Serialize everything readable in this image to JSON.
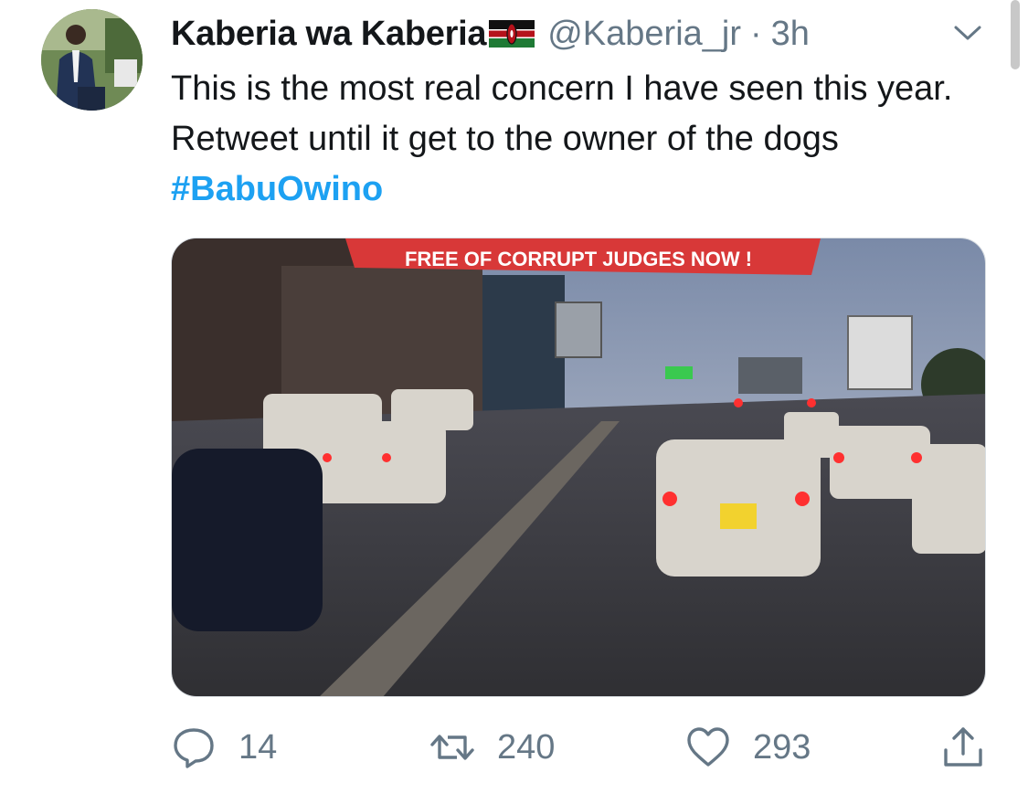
{
  "tweet": {
    "author_name": "Kaberia wa Kaberia",
    "handle": "@Kaberia_jr",
    "separator": "·",
    "time": "3h",
    "text": "This is the most real concern I have seen this year. Retweet until it get to the owner of the dogs ",
    "hashtag": "#BabuOwino",
    "author_flag_icon": "kenya-flag-icon",
    "menu_icon": "chevron-down-icon"
  },
  "media": {
    "banner_text": "FREE OF CORRUPT JUDGES NOW !"
  },
  "actions": {
    "reply_count": "14",
    "retweet_count": "240",
    "like_count": "293",
    "icons": [
      "reply-icon",
      "retweet-icon",
      "like-icon",
      "share-icon"
    ]
  },
  "colors": {
    "accent": "#1da1f2",
    "muted": "#657786",
    "text": "#14171a"
  }
}
